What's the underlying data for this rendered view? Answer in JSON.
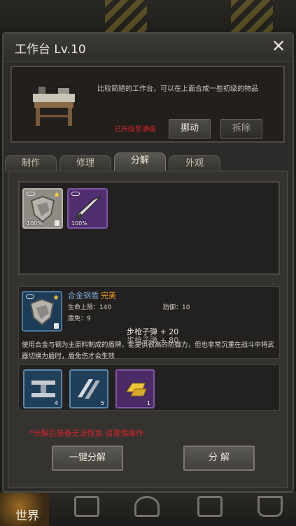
{
  "window": {
    "title": "工作台 Lv.10",
    "close_icon": "close-icon"
  },
  "info": {
    "description": "比较简陋的工作台，可以在上面合成一些初级的物品",
    "status": "已升级至满级",
    "move_label": "挪动",
    "remove_label": "拆除"
  },
  "tabs": [
    {
      "label": "制作",
      "active": false
    },
    {
      "label": "修理",
      "active": false
    },
    {
      "label": "分解",
      "active": true
    },
    {
      "label": "外观",
      "active": false
    }
  ],
  "inventory": [
    {
      "icon": "alloy-shield-icon",
      "count": "100%",
      "locked": true,
      "starred": true,
      "rarity": "grey"
    },
    {
      "icon": "knife-icon",
      "count": "100%",
      "locked": false,
      "starred": false,
      "rarity": "purple"
    }
  ],
  "selected_item": {
    "name": "合金钢盾",
    "quality": "完美",
    "stats": {
      "hp_max": "生命上限：140",
      "defense": "防御：10",
      "shield_block": "盾免：9"
    },
    "yield_1": "步枪子弹 + 20",
    "yield_2": "步枪子弹 + 80",
    "description": "使用合金与钢为主原料制成的盾牌，能提供很高的防御力，但也非常沉重在战斗中将武器切换为盾时，盾免伤才会生效"
  },
  "materials": [
    {
      "icon": "steel-beam-icon",
      "count": "4",
      "rarity": "blue"
    },
    {
      "icon": "steel-plate-icon",
      "count": "5",
      "rarity": "blue"
    },
    {
      "icon": "gold-bar-icon",
      "count": "1",
      "rarity": "purple"
    }
  ],
  "warning": "*分解后装备无法恢复,请谨慎操作",
  "actions": {
    "quick_label": "一键分解",
    "disassemble_label": "分 解"
  },
  "navbar": {
    "world_label": "世界"
  },
  "colors": {
    "accent_red": "#d0242a",
    "quality_orange": "#f09a22",
    "item_name_blue": "#7fa8dc"
  }
}
